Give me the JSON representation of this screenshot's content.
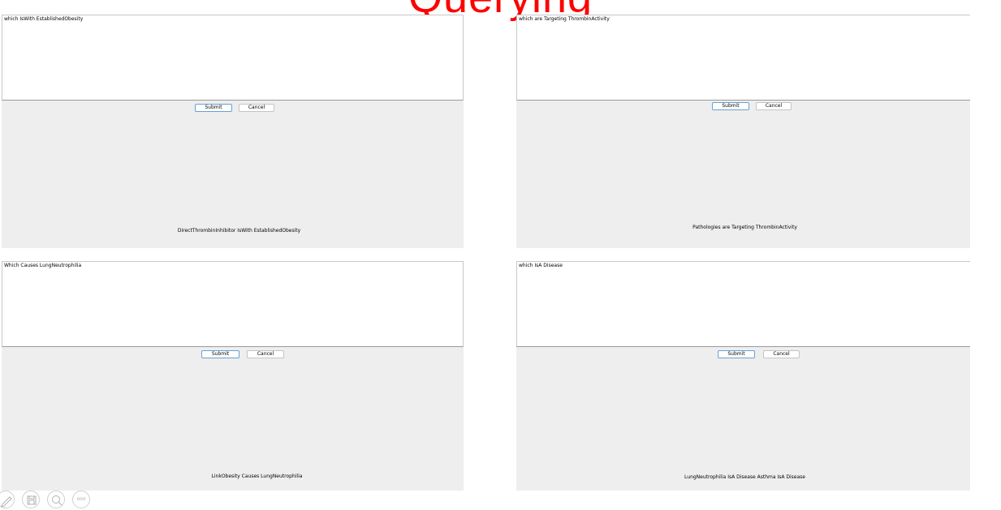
{
  "slide": {
    "title": "Querying"
  },
  "panels": [
    {
      "query": "which IsWith EstablishedObesity",
      "submit_label": "Submit",
      "cancel_label": "Cancel",
      "result": "DirectThrombinInhibitor  IsWith  EstablishedObesity"
    },
    {
      "query": "which are Targeting ThrombinActivity",
      "submit_label": "Submit",
      "cancel_label": "Cancel",
      "result": "Pathologies  are  Targeting  ThrombinActivity"
    },
    {
      "query": "Which Causes LungNeutrophilia",
      "submit_label": "Submit",
      "cancel_label": "Cancel",
      "result": "LinkObesity  Causes  LungNeutrophilia"
    },
    {
      "query": "which IsA Disease",
      "submit_label": "Submit",
      "cancel_label": "Cancel",
      "result": "LungNeutrophilia  IsA  Disease  Asthma  IsA  Disease"
    }
  ],
  "toolbar": {
    "icons": [
      "pen-icon",
      "save-icon",
      "zoom-icon",
      "more-icon"
    ],
    "more_label": "ooo"
  }
}
